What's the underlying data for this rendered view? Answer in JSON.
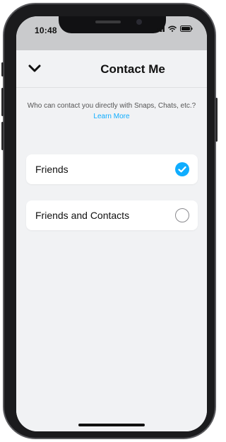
{
  "status_bar": {
    "time": "10:48",
    "icons": [
      "signal-icon",
      "wifi-icon",
      "battery-icon"
    ]
  },
  "header": {
    "title": "Contact Me",
    "back_icon": "chevron-down-icon"
  },
  "description": {
    "text": "Who can contact you directly with Snaps, Chats, etc.?",
    "link": "Learn More"
  },
  "options": [
    {
      "label": "Friends",
      "selected": true
    },
    {
      "label": "Friends and Contacts",
      "selected": false
    }
  ],
  "colors": {
    "accent": "#0fadff",
    "background": "#f1f2f4",
    "card": "#ffffff",
    "radio_border": "#8a8a8e"
  }
}
